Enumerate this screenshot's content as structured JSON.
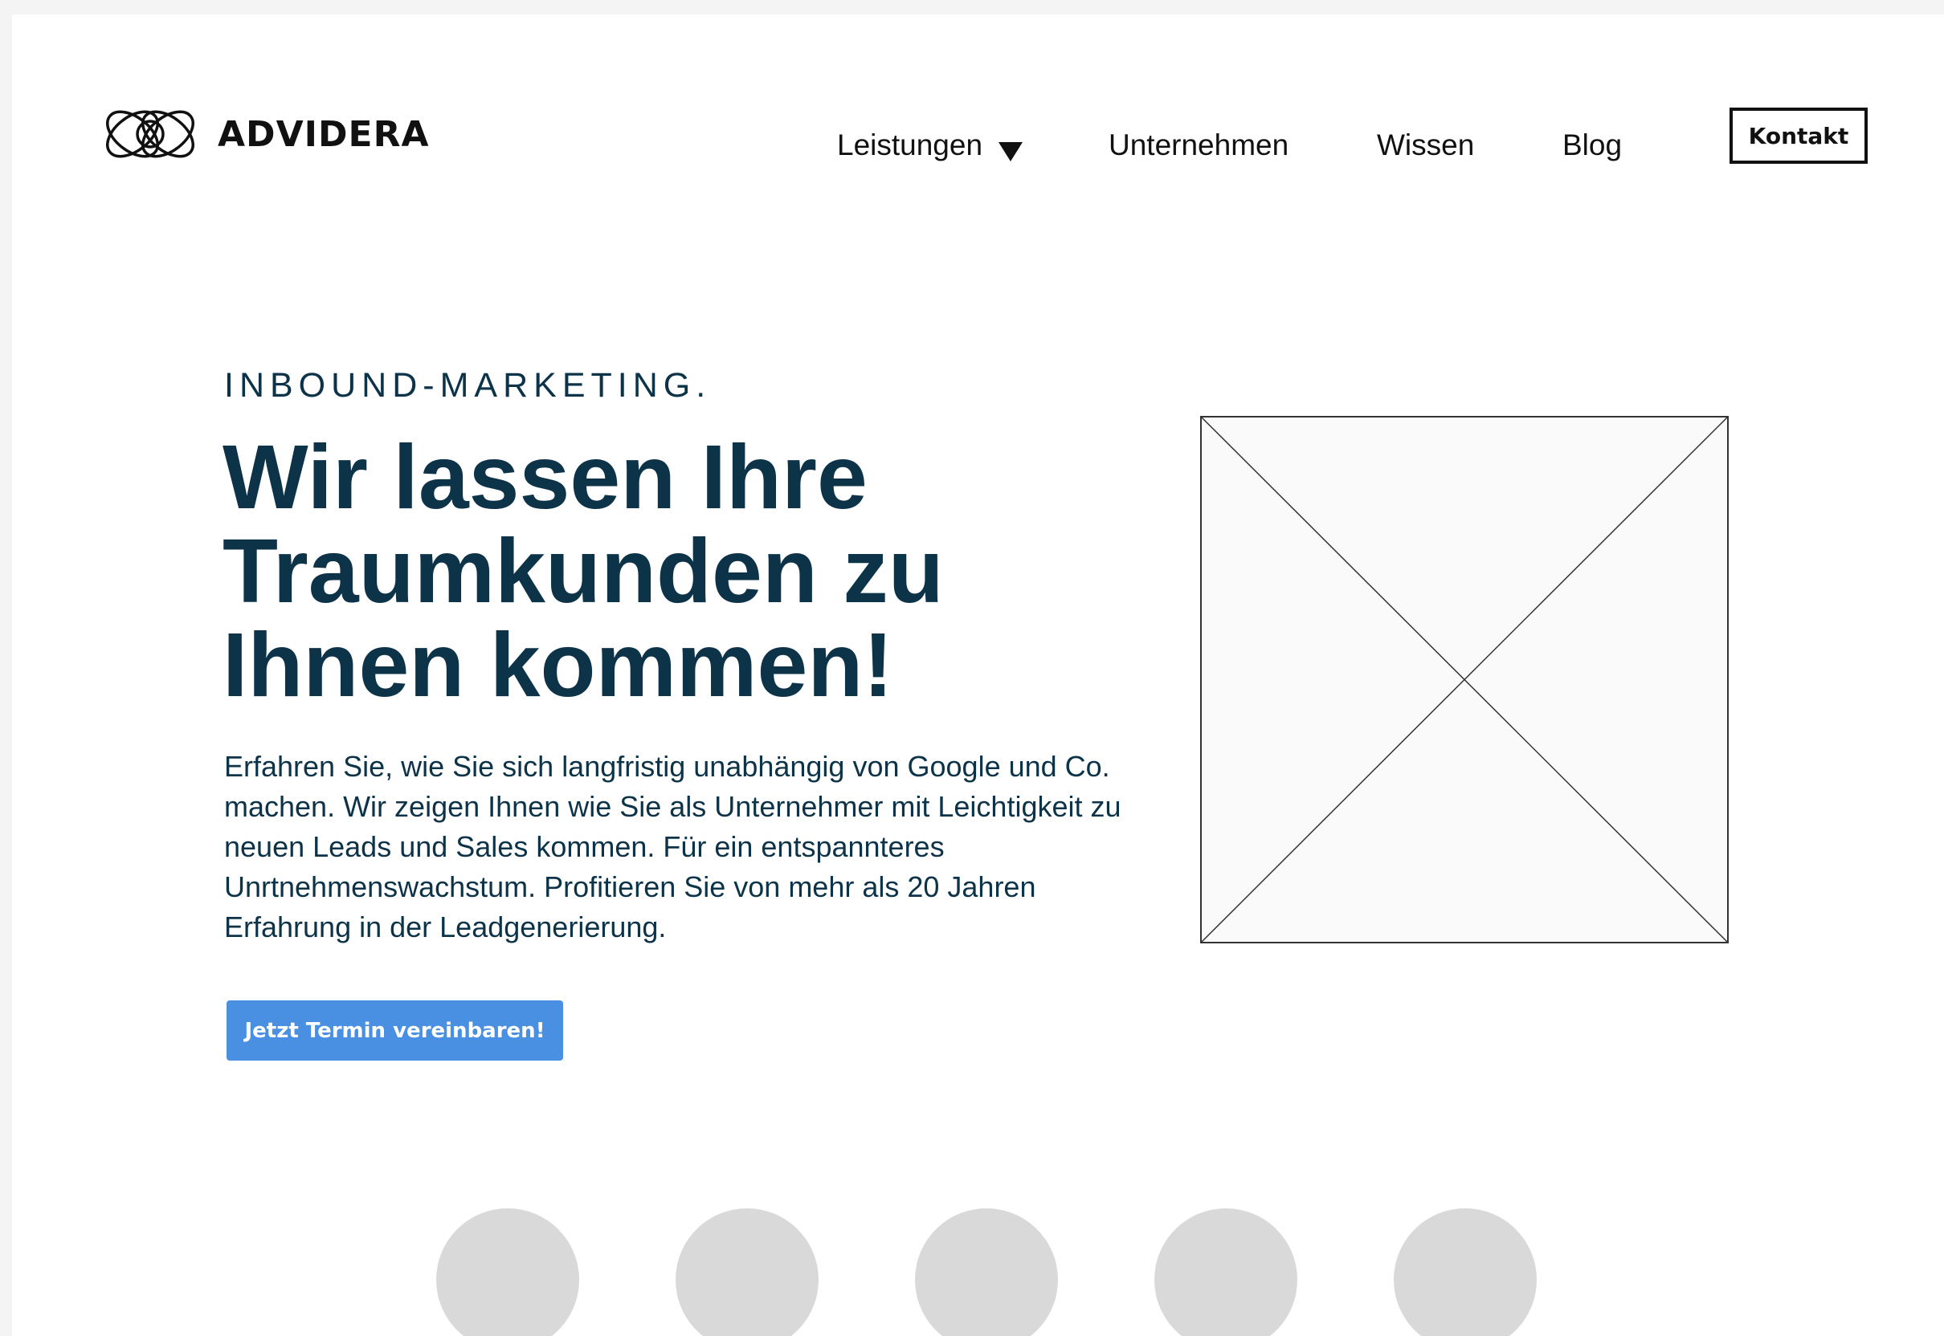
{
  "brand": {
    "name": "ADVIDERA",
    "logo_icon": "interlocking-rings-logo"
  },
  "nav": {
    "items": [
      {
        "label": "Leistungen",
        "has_dropdown": true
      },
      {
        "label": "Unternehmen"
      },
      {
        "label": "Wissen"
      },
      {
        "label": "Blog"
      }
    ],
    "contact_label": "Kontakt"
  },
  "hero": {
    "eyebrow": "INBOUND-MARKETING.",
    "headline": "Wir lassen Ihre Traumkunden zu Ihnen kommen!",
    "body": "Erfahren Sie, wie Sie sich langfristig unabhängig von Google und Co. machen. Wir zeigen Ihnen wie Sie als Unternehmer mit Leichtigkeit zu neuen Leads und Sales kommen. Für ein entspannteres Unrtnehmenswachstum. Profitieren Sie von mehr als 20 Jahren Erfahrung in der Leadgenerierung.",
    "cta_label": "Jetzt Termin vereinbaren!",
    "image": "image-placeholder"
  },
  "colors": {
    "heading": "#0d3349",
    "cta_background": "#4a90e2",
    "avatar_placeholder": "#d9d9d9"
  }
}
